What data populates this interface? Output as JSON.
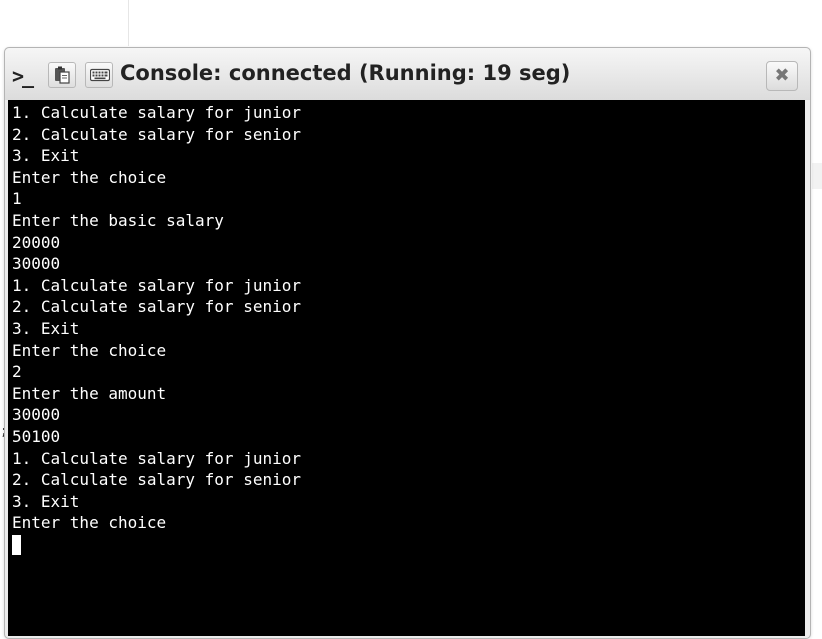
{
  "background": {
    "edge_glyph": ";"
  },
  "console": {
    "title": "Console: connected (Running: 19 seg)",
    "prompt_icon_text": ">_",
    "close_glyph": "✖",
    "toolbar": [
      {
        "icon": "paste-icon"
      },
      {
        "icon": "keyboard-icon"
      }
    ],
    "output_lines": [
      "1. Calculate salary for junior",
      "2. Calculate salary for senior",
      "3. Exit",
      "Enter the choice",
      "1",
      "Enter the basic salary",
      "20000",
      "30000",
      "1. Calculate salary for junior",
      "2. Calculate salary for senior",
      "3. Exit",
      "Enter the choice",
      "2",
      "Enter the amount",
      "30000",
      "50100",
      "1. Calculate salary for junior",
      "2. Calculate salary for senior",
      "3. Exit",
      "Enter the choice"
    ],
    "colors": {
      "terminal_bg": "#000000",
      "terminal_fg": "#ffffff",
      "titlebar_bg": "#e6e6e6"
    }
  }
}
